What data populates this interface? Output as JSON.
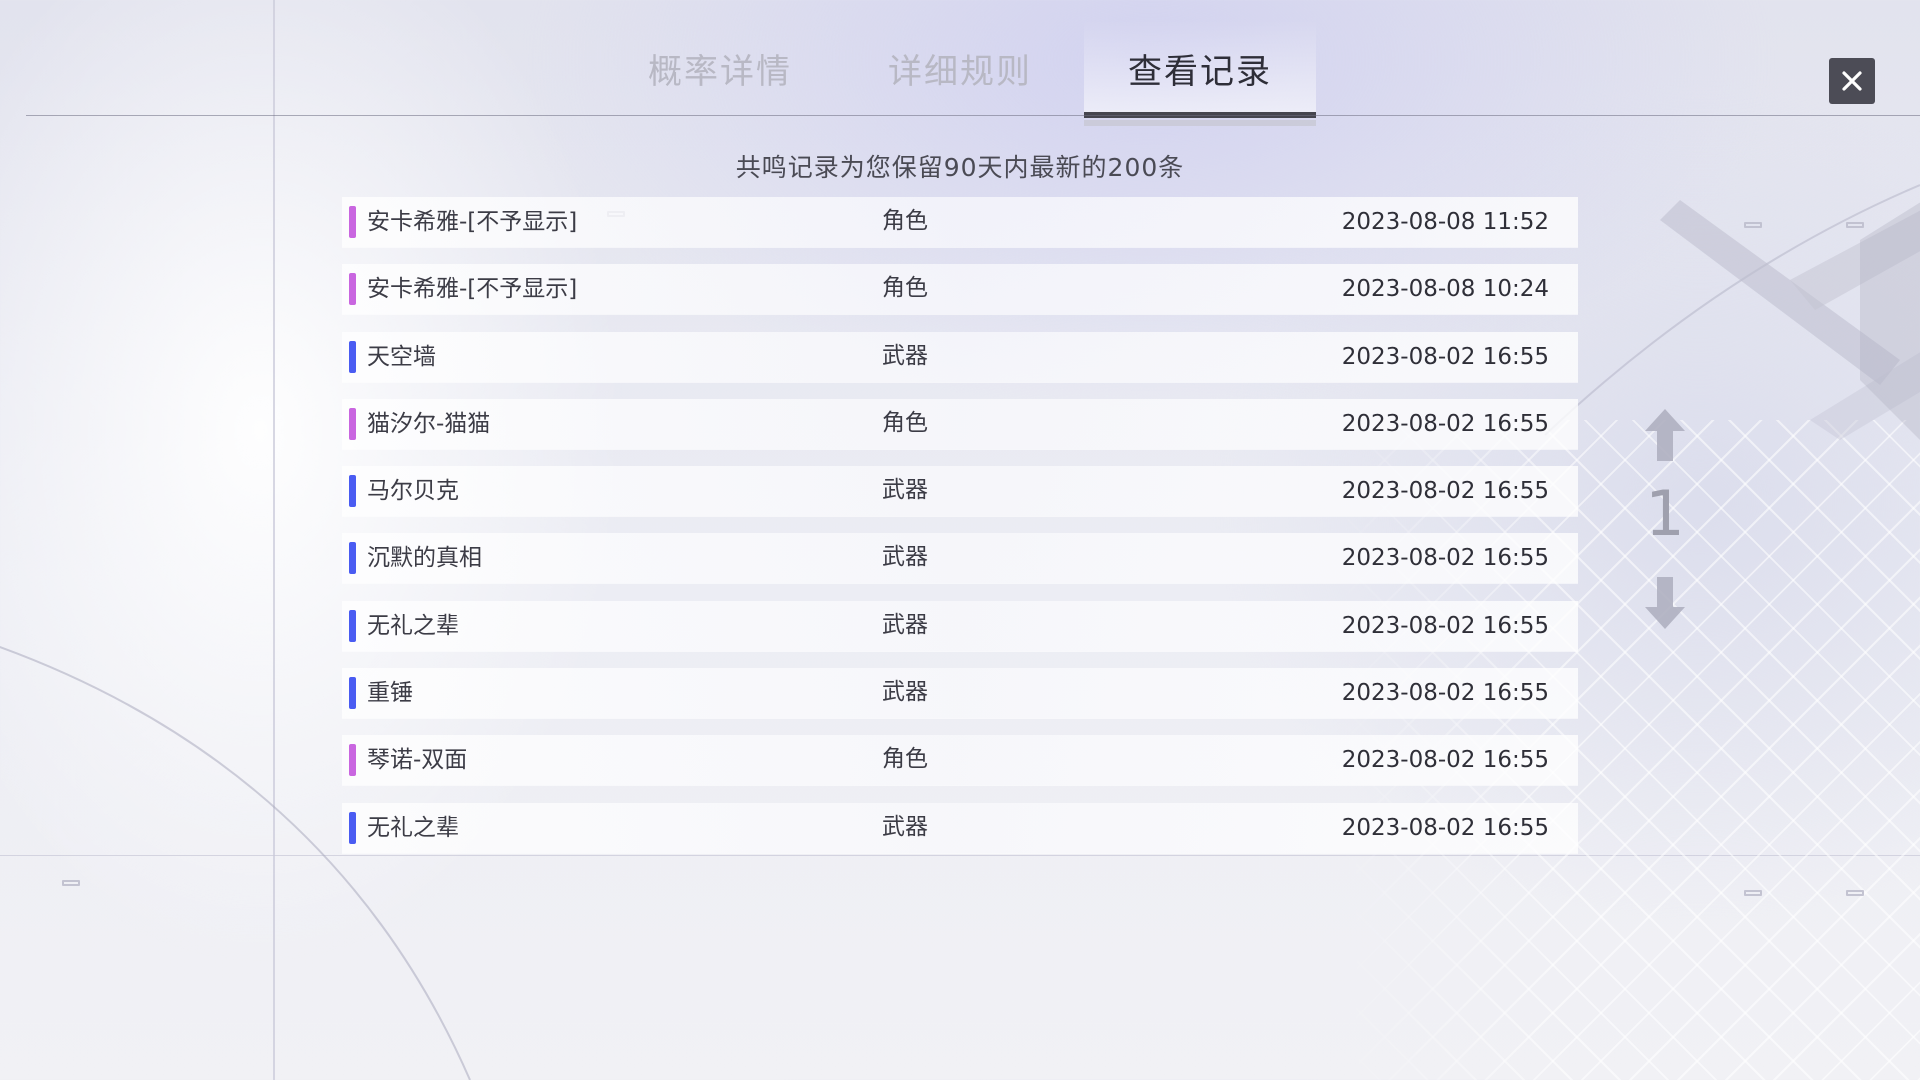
{
  "tabs": [
    {
      "label": "概率详情",
      "active": false
    },
    {
      "label": "详细规则",
      "active": false
    },
    {
      "label": "查看记录",
      "active": true
    }
  ],
  "subtitle": "共鸣记录为您保留90天内最新的200条",
  "colors": {
    "character": "#c966e0",
    "weapon": "#4a5cf2"
  },
  "records": [
    {
      "name": "安卡希雅-[不予显示]",
      "type": "角色",
      "time": "2023-08-08 11:52",
      "kind": "character"
    },
    {
      "name": "安卡希雅-[不予显示]",
      "type": "角色",
      "time": "2023-08-08 10:24",
      "kind": "character"
    },
    {
      "name": "天空墙",
      "type": "武器",
      "time": "2023-08-02 16:55",
      "kind": "weapon"
    },
    {
      "name": "猫汐尔-猫猫",
      "type": "角色",
      "time": "2023-08-02 16:55",
      "kind": "character"
    },
    {
      "name": "马尔贝克",
      "type": "武器",
      "time": "2023-08-02 16:55",
      "kind": "weapon"
    },
    {
      "name": "沉默的真相",
      "type": "武器",
      "time": "2023-08-02 16:55",
      "kind": "weapon"
    },
    {
      "name": "无礼之辈",
      "type": "武器",
      "time": "2023-08-02 16:55",
      "kind": "weapon"
    },
    {
      "name": "重锤",
      "type": "武器",
      "time": "2023-08-02 16:55",
      "kind": "weapon"
    },
    {
      "name": "琴诺-双面",
      "type": "角色",
      "time": "2023-08-02 16:55",
      "kind": "character"
    },
    {
      "name": "无礼之辈",
      "type": "武器",
      "time": "2023-08-02 16:55",
      "kind": "weapon"
    }
  ],
  "pager": {
    "page": "1"
  }
}
